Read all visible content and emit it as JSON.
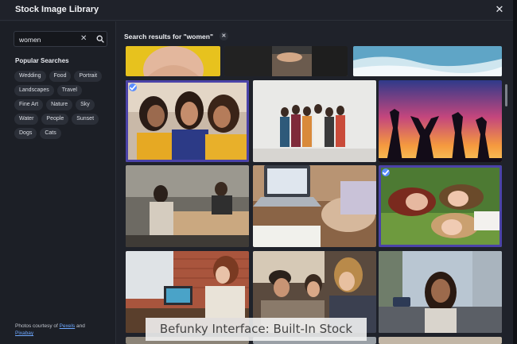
{
  "window": {
    "title": "Stock Image Library"
  },
  "search": {
    "value": "women",
    "placeholder": ""
  },
  "popular": {
    "title": "Popular Searches",
    "chips": [
      "Wedding",
      "Food",
      "Portrait",
      "Landscapes",
      "Travel",
      "Fine Art",
      "Nature",
      "Sky",
      "Water",
      "People",
      "Sunset",
      "Dogs",
      "Cats"
    ]
  },
  "credit": {
    "prefix": "Photos courtesy of",
    "link1": "Pexels",
    "joiner": "and",
    "link2": "Pixabay"
  },
  "results": {
    "title": "Search results for \"women\""
  },
  "thumbnails": [
    {
      "name": "photo-yellow-top",
      "selected": false
    },
    {
      "name": "photo-business-handshake",
      "selected": false
    },
    {
      "name": "photo-ocean-surf",
      "selected": false
    },
    {
      "name": "photo-three-women-laughing",
      "selected": true
    },
    {
      "name": "photo-group-white-wall",
      "selected": false
    },
    {
      "name": "photo-silhouettes-sunset",
      "selected": false
    },
    {
      "name": "photo-office-coworking",
      "selected": false
    },
    {
      "name": "photo-laptop-desk",
      "selected": false
    },
    {
      "name": "photo-women-lying-grass",
      "selected": true
    },
    {
      "name": "photo-woman-laptop-brick",
      "selected": false
    },
    {
      "name": "photo-friends-group",
      "selected": false
    },
    {
      "name": "photo-woman-city-street",
      "selected": false
    }
  ],
  "caption": "Befunky Interface: Built-In Stock",
  "colors": {
    "accent": "#4b43a8",
    "check": "#5a8dff",
    "link": "#6ea8ff"
  }
}
